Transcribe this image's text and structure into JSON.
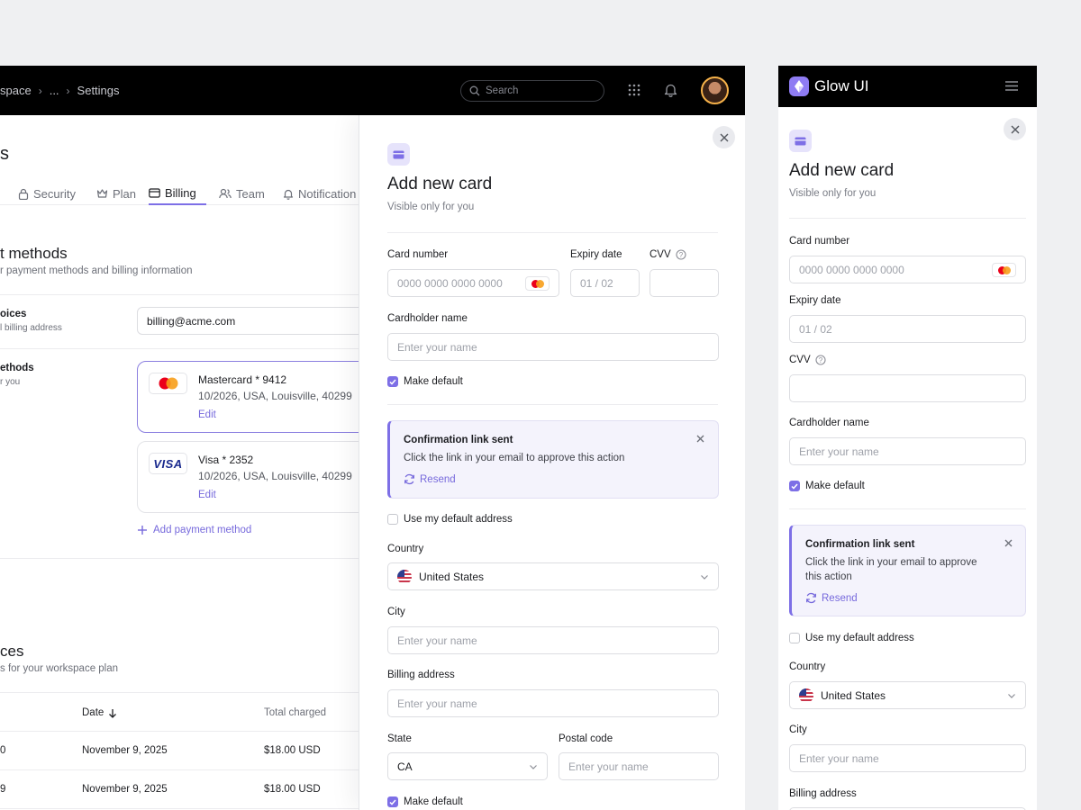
{
  "header": {
    "breadcrumb": [
      "space",
      "...",
      "Settings"
    ],
    "search_placeholder": "Search"
  },
  "page": {
    "title": "s",
    "tabs": [
      "Security",
      "Plan",
      "Billing",
      "Team",
      "Notification"
    ],
    "active_tab": "Billing"
  },
  "payment_section": {
    "title": "t methods",
    "subtitle": "r payment methods and billing information",
    "invoices_label": "oices",
    "invoices_sub": "l billing address",
    "email_value": "billing@acme.com",
    "methods_label": "ethods",
    "methods_sub": "r you",
    "cards": [
      {
        "name": "Mastercard * 9412",
        "desc": "10/2026, USA, Louisville, 40299",
        "edit": "Edit"
      },
      {
        "name": "Visa * 2352",
        "desc": "10/2026, USA, Louisville, 40299",
        "edit": "Edit"
      }
    ],
    "add_payment": "Add payment method"
  },
  "invoices_section": {
    "title": "ces",
    "subtitle": "s for your workspace plan",
    "columns": [
      "Date",
      "Total charged"
    ],
    "rows": [
      {
        "id": "0",
        "date": "November 9, 2025",
        "total": "$18.00 USD"
      },
      {
        "id": "9",
        "date": "November 9, 2025",
        "total": "$18.00 USD"
      }
    ]
  },
  "drawer": {
    "title": "Add new card",
    "subtitle": "Visible only for you",
    "card_number_label": "Card number",
    "card_number_placeholder": "0000 0000 0000 0000",
    "expiry_label": "Expiry date",
    "expiry_placeholder": "01 / 02",
    "cvv_label": "CVV",
    "cardholder_label": "Cardholder name",
    "name_placeholder": "Enter your name",
    "make_default": "Make default",
    "alert_title": "Confirmation link sent",
    "alert_body": "Click the link in your email to approve this action",
    "alert_body_l1": "Click the link in your email to approve",
    "alert_body_l2": "this action",
    "resend": "Resend",
    "use_default_address": "Use my default address",
    "country_label": "Country",
    "country_value": "United States",
    "city_label": "City",
    "billing_address_label": "Billing address",
    "state_label": "State",
    "state_value": "CA",
    "postal_label": "Postal code"
  },
  "mobile": {
    "app_name": "Glow UI"
  },
  "colors": {
    "accent": "#7d6fe6",
    "topbar": "#000000"
  }
}
